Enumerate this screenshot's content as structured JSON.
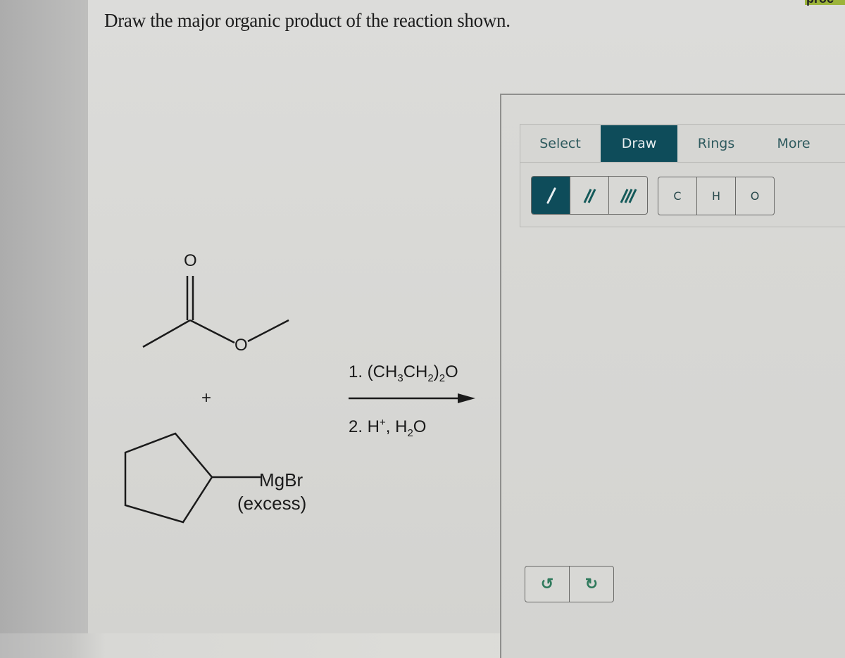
{
  "question": {
    "prompt": "Draw the major organic product of the reaction shown."
  },
  "header_banner": {
    "partial_text": "proc",
    "color": "#9cb43a"
  },
  "reaction": {
    "reactant1": {
      "name": "methyl acetate",
      "atoms": {
        "carbonyl_O": "O",
        "ester_O": "O"
      }
    },
    "plus": "+",
    "reactant2": {
      "name": "cyclopentylmagnesium bromide",
      "label": "MgBr",
      "note": "(excess)"
    },
    "conditions": {
      "step1_prefix": "1. (CH",
      "step1_sub1": "3",
      "step1_mid": "CH",
      "step1_sub2": "2",
      "step1_close": ")",
      "step1_sub3": "2",
      "step1_end": "O",
      "step2_prefix": "2. H",
      "step2_sup": "+",
      "step2_mid": ", H",
      "step2_sub": "2",
      "step2_end": "O"
    }
  },
  "editor": {
    "tabs": [
      {
        "label": "Select",
        "active": false
      },
      {
        "label": "Draw",
        "active": true
      },
      {
        "label": "Rings",
        "active": false
      },
      {
        "label": "More",
        "active": false
      }
    ],
    "bond_tools": [
      {
        "name": "single-bond",
        "active": true
      },
      {
        "name": "double-bond",
        "active": false
      },
      {
        "name": "triple-bond",
        "active": false
      }
    ],
    "atom_tools": [
      "C",
      "H",
      "O"
    ],
    "history": [
      {
        "name": "undo",
        "glyph": "↺"
      },
      {
        "name": "redo",
        "glyph": "↻"
      }
    ],
    "accent_color": "#0e4c5a"
  }
}
